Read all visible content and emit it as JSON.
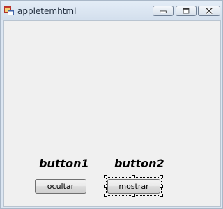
{
  "window": {
    "title": "appletemhtml",
    "icon": "app-form-icon",
    "caption_buttons": [
      "minimize-icon",
      "maximize-icon",
      "close-icon"
    ]
  },
  "form": {
    "label1": "button1",
    "label2": "button2",
    "button_ocultar": "ocultar",
    "button_mostrar": "mostrar",
    "selected_control": "mostrar"
  },
  "colors": {
    "client_background": "#f0f0f0",
    "title_bar": "#dce6f2"
  }
}
